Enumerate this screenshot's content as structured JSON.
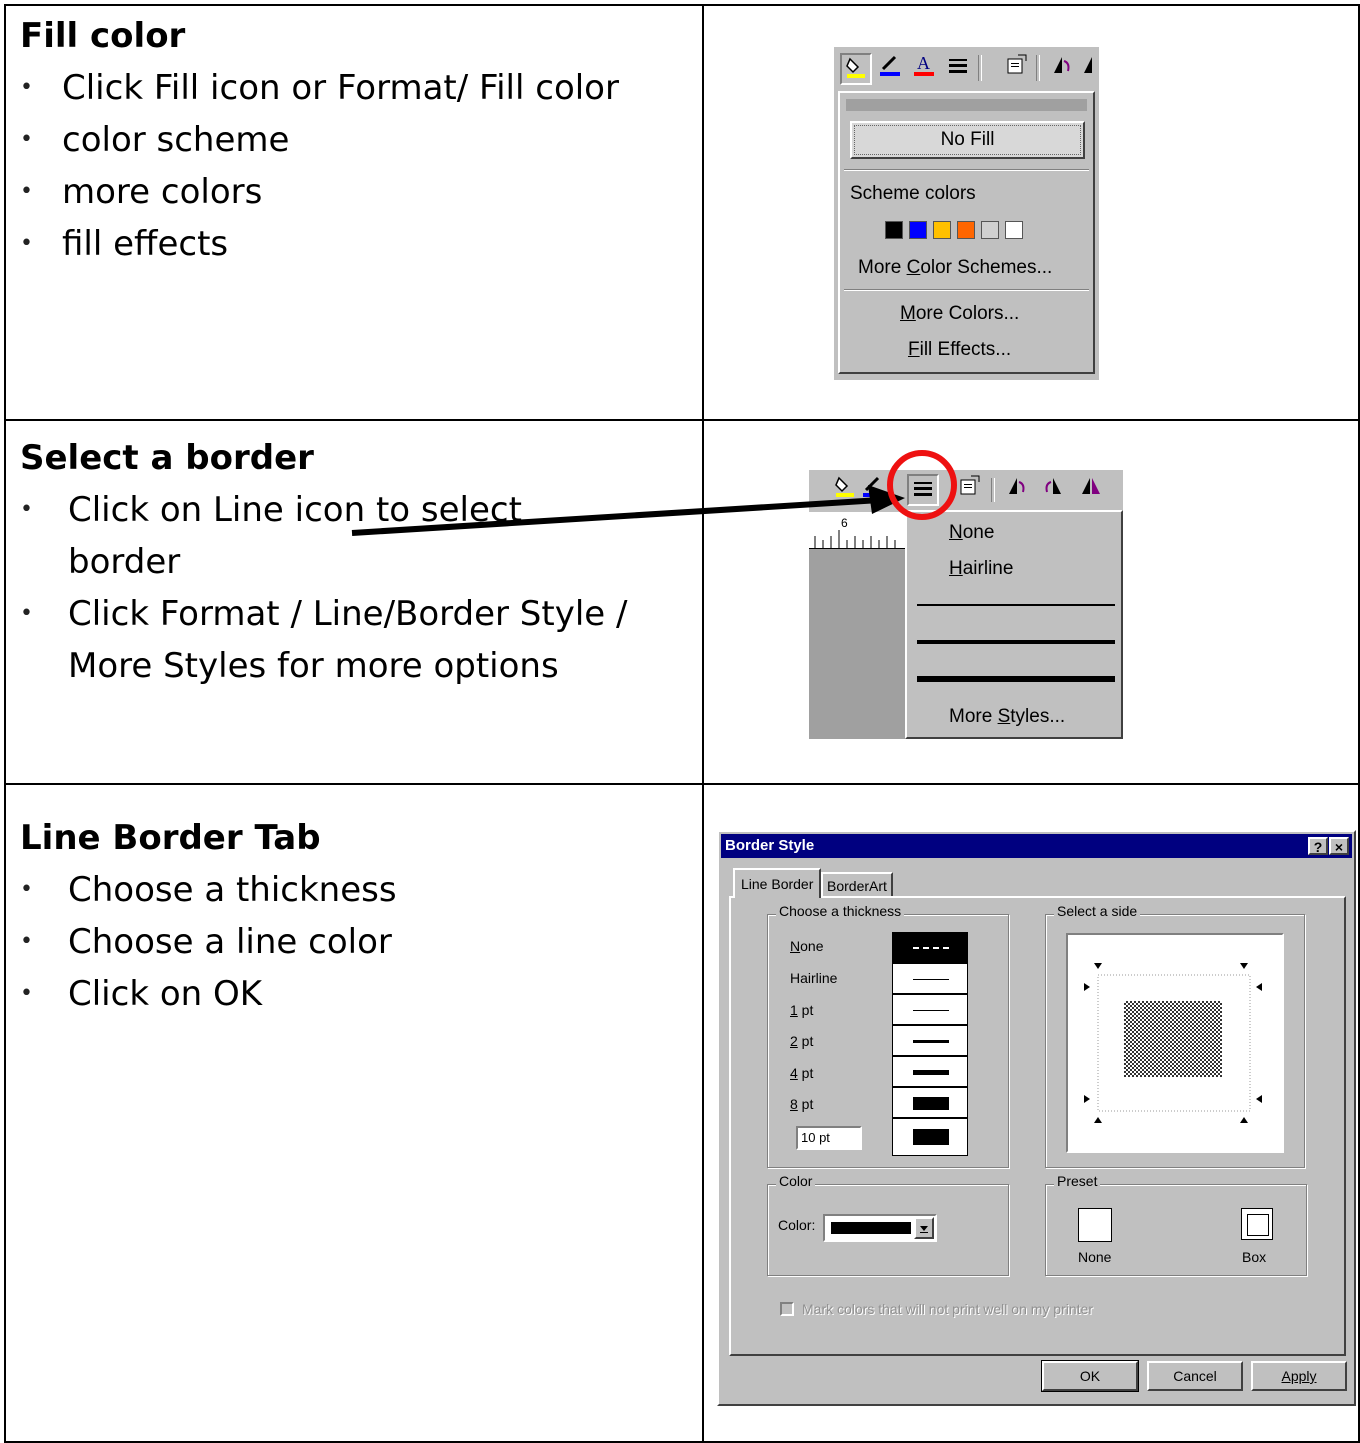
{
  "section1": {
    "heading": "Fill color",
    "bullets": [
      "Click Fill icon or Format/ Fill color",
      "color scheme",
      "more colors",
      "fill effects"
    ],
    "menu": {
      "no_fill": "No Fill",
      "scheme_label": "Scheme colors",
      "swatches": [
        "#000000",
        "#0000ff",
        "#ffc000",
        "#ff6600",
        "#d0d0d0",
        "#ffffff"
      ],
      "more_schemes_pre": "More ",
      "more_schemes_ul": "C",
      "more_schemes_post": "olor Schemes...",
      "more_colors_pre": "",
      "more_colors_ul": "M",
      "more_colors_post": "ore Colors...",
      "fill_effects_pre": "",
      "fill_effects_ul": "F",
      "fill_effects_post": "ill Effects..."
    }
  },
  "section2": {
    "heading": "Select a border",
    "bullets": [
      "Click on Line icon to select border",
      "Click Format / Line/Border Style / More Styles for more options"
    ],
    "menu": {
      "none_ul": "N",
      "none_rest": "one",
      "hairline_ul": "H",
      "hairline_rest": "airline",
      "more_pre": "More ",
      "more_ul": "S",
      "more_post": "tyles...",
      "ruler_mark": "6"
    }
  },
  "section3": {
    "heading": "Line Border Tab",
    "bullets": [
      "Choose a thickness",
      "Choose a line color",
      "Click on OK"
    ],
    "dialog": {
      "title": "Border Style",
      "help_btn": "?",
      "close_btn": "×",
      "tab_line_border": "Line Border",
      "tab_borderart": "BorderArt",
      "thickness_group": "Choose a thickness",
      "side_group": "Select a side",
      "thickness": [
        {
          "ul": "N",
          "rest": "one"
        },
        {
          "ul": "",
          "rest": "Hairline"
        },
        {
          "ul": "1",
          "rest": " pt"
        },
        {
          "ul": "2",
          "rest": " pt"
        },
        {
          "ul": "4",
          "rest": " pt"
        },
        {
          "ul": "8",
          "rest": " pt"
        }
      ],
      "custom_value": "10 pt",
      "color_group": "Color",
      "color_label": "Color:",
      "preset_group": "Preset",
      "preset_none": "None",
      "preset_box": "Box",
      "mark_colors": "Mark colors that will not print well on my printer",
      "ok": "OK",
      "cancel": "Cancel",
      "apply": "Apply"
    }
  }
}
